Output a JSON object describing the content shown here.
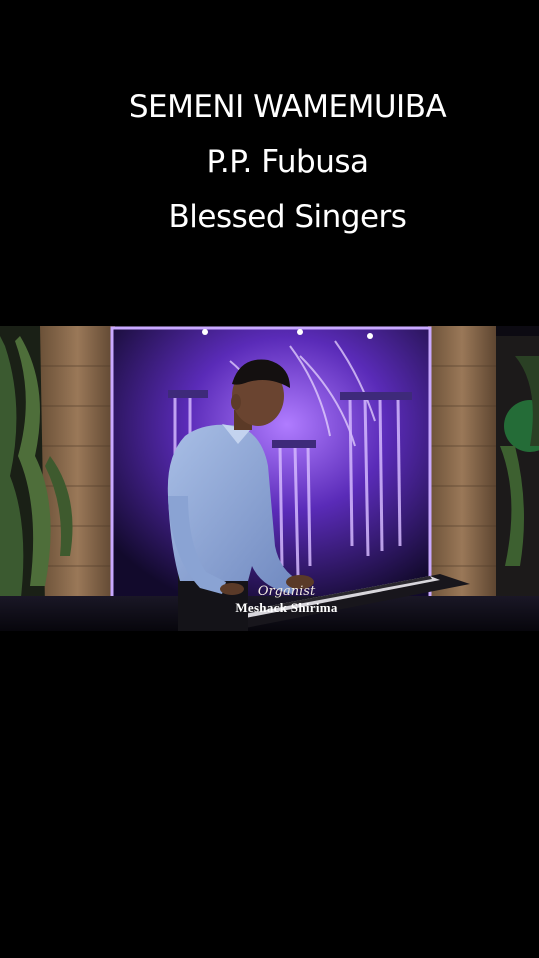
{
  "title": {
    "line1": "SEMENI WAMEMUIBA",
    "line2": "P.P. Fubusa",
    "line3": "Blessed Singers"
  },
  "caption": {
    "role": "Organist",
    "name": "Meshack Shirima"
  },
  "colors": {
    "background": "#000000",
    "fountain_glow": "#7b3fe4",
    "brick_wall": "#8a6a4e",
    "shirt": "#8fa9d8",
    "green_light": "#2fd15a"
  }
}
